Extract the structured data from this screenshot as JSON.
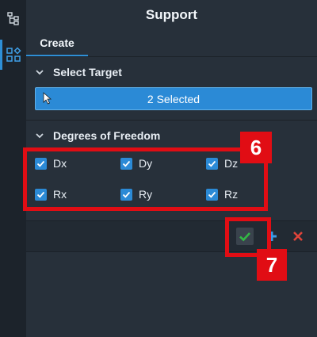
{
  "panel": {
    "title": "Support",
    "tabs": [
      {
        "label": "Create"
      }
    ]
  },
  "select_target": {
    "header": "Select Target",
    "button_label": "2 Selected"
  },
  "dof": {
    "header": "Degrees of Freedom",
    "items": [
      {
        "label": "Dx",
        "checked": true
      },
      {
        "label": "Dy",
        "checked": true
      },
      {
        "label": "Dz",
        "checked": true
      },
      {
        "label": "Rx",
        "checked": true
      },
      {
        "label": "Ry",
        "checked": true
      },
      {
        "label": "Rz",
        "checked": true
      }
    ]
  },
  "footer": {
    "actions": [
      "ok-icon",
      "add-icon",
      "cancel-icon"
    ]
  },
  "callouts": [
    {
      "label": "6",
      "target": "degrees-of-freedom-checkboxes"
    },
    {
      "label": "7",
      "target": "ok-button"
    }
  ],
  "colors": {
    "accent": "#2b8ad6",
    "ok": "#33b845",
    "cancel": "#e0443a",
    "callout": "#e10d14",
    "panel_bg": "#27303a"
  }
}
